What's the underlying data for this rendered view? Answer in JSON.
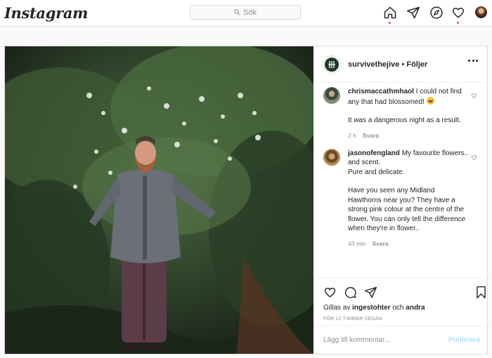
{
  "app": {
    "logo_text": "Instagram"
  },
  "search": {
    "placeholder": "Sök"
  },
  "nav": {
    "icons": [
      "home-icon",
      "direct-icon",
      "explore-icon",
      "activity-icon",
      "profile-avatar"
    ]
  },
  "post": {
    "author": "survivethejive",
    "follow_status": "Följer",
    "separator": "•",
    "comments": [
      {
        "user": "chrismaccathmhaol",
        "paragraphs": [
          [
            "I could not find any that had blossomed!"
          ],
          [
            "It was a dangerous night as a result."
          ]
        ],
        "time": "2 h",
        "reply": "Svara"
      },
      {
        "user": "jasonofengland",
        "paragraphs": [
          [
            "My favourite flowers..",
            "and scent.",
            "Pure and delicate."
          ],
          [
            "Have you seen any Midland Hawthorns near you? They have a strong pink colour at the centre of the flower. You can only tell the difference when they're in flower.."
          ]
        ],
        "time": "43 min",
        "reply": "Svara"
      }
    ],
    "likes_prefix": "Gillas av",
    "liked_by": "ingestohter",
    "likes_joiner": "och",
    "likes_others": "andra",
    "time_ago": "FÖR 12 TIMMAR SEDAN",
    "add_comment_placeholder": "Lägg till kommentar...",
    "publish_label": "Publicera"
  },
  "colors": {
    "border": "#dbdbdb",
    "notification_dot": "#ed4956",
    "publish_disabled": "#b2dffc",
    "muted_text": "#8e8e8e"
  }
}
